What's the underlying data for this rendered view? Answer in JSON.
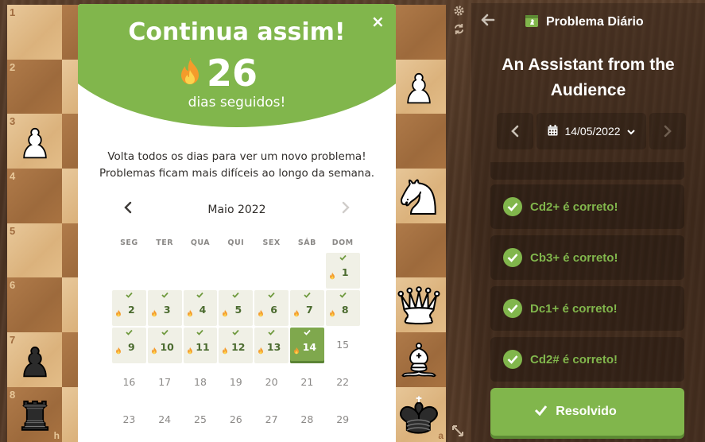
{
  "board": {
    "ranks": [
      "1",
      "2",
      "3",
      "4",
      "5",
      "6",
      "7",
      "8"
    ],
    "files": [
      "h",
      "a"
    ]
  },
  "panel": {
    "title": "Problema Diário",
    "puzzle_name": "An Assistant from the Audience",
    "date": "14/05/2022",
    "moves": [
      {
        "text": "Cd2+ é correto!"
      },
      {
        "text": "Cb3+ é correto!"
      },
      {
        "text": "Dc1+ é correto!"
      },
      {
        "text": "Cd2# é correto!"
      }
    ],
    "solved_label": "Resolvido"
  },
  "modal": {
    "title": "Continua assim!",
    "streak_number": "26",
    "streak_label": "dias seguidos!",
    "description_line1": "Volta todos os dias para ver um novo problema!",
    "description_line2": "Problemas ficam mais difíceis ao longo da semana.",
    "close_symbol": "×",
    "calendar": {
      "month": "Maio 2022",
      "weekdays": [
        "SEG",
        "TER",
        "QUA",
        "QUI",
        "SEX",
        "SÁB",
        "DOM"
      ],
      "rows": [
        [
          null,
          null,
          null,
          null,
          null,
          null,
          {
            "d": "1",
            "done": true
          }
        ],
        [
          {
            "d": "2",
            "done": true
          },
          {
            "d": "3",
            "done": true
          },
          {
            "d": "4",
            "done": true
          },
          {
            "d": "5",
            "done": true
          },
          {
            "d": "6",
            "done": true
          },
          {
            "d": "7",
            "done": true
          },
          {
            "d": "8",
            "done": true
          }
        ],
        [
          {
            "d": "9",
            "done": true
          },
          {
            "d": "10",
            "done": true
          },
          {
            "d": "11",
            "done": true
          },
          {
            "d": "12",
            "done": true
          },
          {
            "d": "13",
            "done": true
          },
          {
            "d": "14",
            "done": true,
            "today": true
          },
          {
            "d": "15"
          }
        ],
        [
          {
            "d": "16"
          },
          {
            "d": "17"
          },
          {
            "d": "18"
          },
          {
            "d": "19"
          },
          {
            "d": "20"
          },
          {
            "d": "21"
          },
          {
            "d": "22"
          }
        ],
        [
          {
            "d": "23"
          },
          {
            "d": "24"
          },
          {
            "d": "25"
          },
          {
            "d": "26"
          },
          {
            "d": "27"
          },
          {
            "d": "28"
          },
          {
            "d": "29"
          }
        ]
      ]
    }
  },
  "colors": {
    "accent_green": "#81b64c",
    "light_square": "#e3bd88",
    "dark_square": "#a97341"
  }
}
